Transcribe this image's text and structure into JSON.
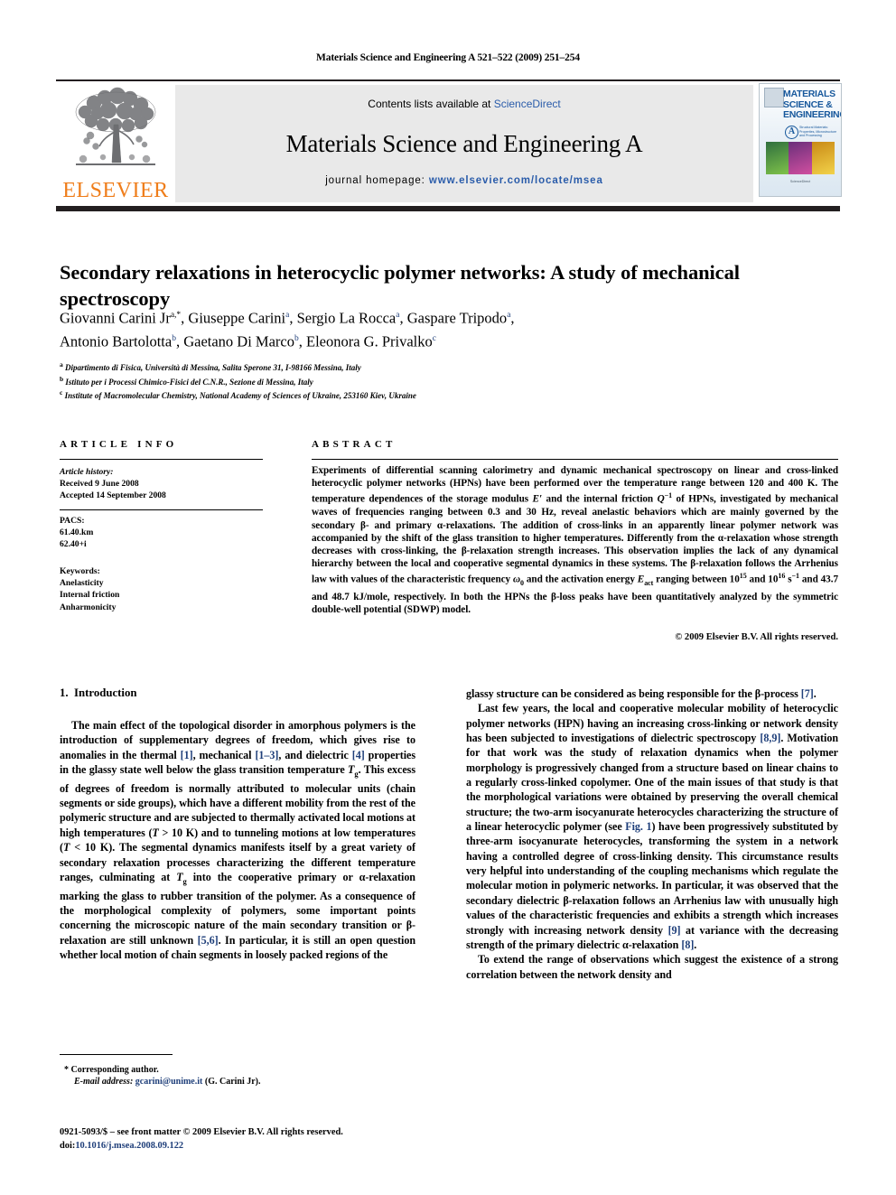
{
  "running_head": "Materials Science and Engineering A 521–522 (2009) 251–254",
  "masthead": {
    "contents_prefix": "Contents lists available at ",
    "sciencedirect": "ScienceDirect",
    "journal_name": "Materials Science and Engineering A",
    "homepage_prefix": "journal homepage:",
    "homepage_url": "www.elsevier.com/locate/msea",
    "publisher": "ELSEVIER",
    "publisher_logo": "elsevier-tree-logo",
    "cover": {
      "title_line1": "MATERIALS",
      "title_line2": "SCIENCE &",
      "title_line3": "ENGINEERING",
      "series_letter": "A",
      "subtitle": "Structural Materials: Properties, Microstructure and Processing",
      "footer": "ScienceDirect"
    },
    "accent_orange": "#ef7d1a",
    "accent_blue": "#2a5caa"
  },
  "article": {
    "title": "Secondary relaxations in heterocyclic polymer networks: A study of mechanical spectroscopy",
    "authors": [
      {
        "name": "Giovanni Carini Jr",
        "marks": "a,*"
      },
      {
        "name": "Giuseppe Carini",
        "marks": "a"
      },
      {
        "name": "Sergio La Rocca",
        "marks": "a"
      },
      {
        "name": "Gaspare Tripodo",
        "marks": "a"
      },
      {
        "name": "Antonio Bartolotta",
        "marks": "b"
      },
      {
        "name": "Gaetano Di Marco",
        "marks": "b"
      },
      {
        "name": "Eleonora G. Privalko",
        "marks": "c"
      }
    ],
    "affiliations": [
      {
        "mark": "a",
        "text": "Dipartimento di Fisica, Università di Messina, Salita Sperone 31, I-98166 Messina, Italy"
      },
      {
        "mark": "b",
        "text": "Istituto per i Processi Chimico-Fisici del C.N.R., Sezione di Messina, Italy"
      },
      {
        "mark": "c",
        "text": "Institute of Macromolecular Chemistry, National Academy of Sciences of Ukraine, 253160 Kiev, Ukraine"
      }
    ]
  },
  "info": {
    "heading": "ARTICLE INFO",
    "history_label": "Article history:",
    "received": "Received 9 June 2008",
    "accepted": "Accepted 14 September 2008",
    "pacs_label": "PACS:",
    "pacs": [
      "61.40.km",
      "62.40+i"
    ],
    "keywords_label": "Keywords:",
    "keywords": [
      "Anelasticity",
      "Internal friction",
      "Anharmonicity"
    ]
  },
  "abstract": {
    "heading": "ABSTRACT",
    "p1_a": "Experiments of differential scanning calorimetry and dynamic mechanical spectroscopy on linear and cross-linked heterocyclic polymer networks (HPNs) have been performed over the temperature range between 120 and 400 K. The temperature dependences of the storage modulus ",
    "sym_Eprime": "E′",
    "p1_b": " and the internal friction ",
    "sym_Q": "Q",
    "sym_Q_sup": "−1",
    "p1_c": " of HPNs, investigated by mechanical waves of frequencies ranging between 0.3 and 30 Hz, reveal anelastic behaviors which are mainly governed by the secondary β- and primary α-relaxations. The addition of cross-links in an apparently linear polymer network was accompanied by the shift of the glass transition to higher temperatures. Differently from the α-relaxation whose strength decreases with cross-linking, the β-relaxation strength increases. This observation implies the lack of any dynamical hierarchy between the local and cooperative segmental dynamics in these systems. The β-relaxation follows the Arrhenius law with values of the characteristic frequency ",
    "sym_omega": "ω",
    "sym_omega_sub": "0",
    "p1_d": " and the activation energy ",
    "sym_E": "E",
    "sym_E_sub": "act",
    "p1_e": " ranging between 10",
    "sym_exp15": "15",
    "p1_f": " and 10",
    "sym_exp16": "16",
    "p1_g": " s",
    "sym_expm1": "−1",
    "p1_h": " and 43.7 and 48.7 kJ/mole, respectively. In both the HPNs the β-loss peaks have been quantitatively analyzed by the symmetric double-well potential (SDWP) model.",
    "copyright": "© 2009 Elsevier B.V. All rights reserved."
  },
  "body": {
    "section_number": "1.",
    "section_title": "Introduction",
    "left": {
      "p1_a": "The main effect of the topological disorder in amorphous polymers is the introduction of supplementary degrees of freedom, which gives rise to anomalies in the thermal ",
      "r1": "[1]",
      "p1_b": ", mechanical ",
      "r2": "[1–3]",
      "p1_c": ", and dielectric ",
      "r3": "[4]",
      "p1_d": " properties in the glassy state well below the glass transition temperature ",
      "sym_Tg": "T",
      "sym_Tg_sub": "g",
      "p1_e": ". This excess of degrees of freedom is normally attributed to molecular units (chain segments or side groups), which have a different mobility from the rest of the polymeric structure and are subjected to thermally activated local motions at high temperatures (",
      "sym_T1": "T",
      "p1_f": " > 10 K) and to tunneling motions at low temperatures (",
      "sym_T2": "T",
      "p1_g": " < 10 K). The segmental dynamics manifests itself by a great variety of secondary relaxation processes characterizing the different temperature ranges, culminating at ",
      "sym_Tg2": "T",
      "sym_Tg2_sub": "g",
      "p1_h": " into the cooperative primary or α-relaxation marking the glass to rubber transition of the polymer. As a consequence of the morphological complexity of polymers, some important points concerning the microscopic nature of the main secondary transition or β-relaxation are still unknown ",
      "r4": "[5,6]",
      "p1_i": ". In particular, it is still an open question whether local motion of chain segments in loosely packed regions of the"
    },
    "right": {
      "p1_a": "glassy structure can be considered as being responsible for the β-process ",
      "r5": "[7]",
      "p1_b": ".",
      "p2_a": "Last few years, the local and cooperative molecular mobility of heterocyclic polymer networks (HPN) having an increasing cross-linking or network density has been subjected to investigations of dielectric spectroscopy ",
      "r6": "[8,9]",
      "p2_b": ". Motivation for that work was the study of relaxation dynamics when the polymer morphology is progressively changed from a structure based on linear chains to a regularly cross-linked copolymer. One of the main issues of that study is that the morphological variations were obtained by preserving the overall chemical structure; the two-arm isocyanurate heterocycles characterizing the structure of a linear heterocyclic polymer (see ",
      "figref": "Fig. 1",
      "p2_c": ") have been progressively substituted by three-arm isocyanurate heterocycles, transforming the system in a network having a controlled degree of cross-linking density. This circumstance results very helpful into understanding of the coupling mechanisms which regulate the molecular motion in polymeric networks. In particular, it was observed that the secondary dielectric β-relaxation follows an Arrhenius law with unusually high values of the characteristic frequencies and exhibits a strength which increases strongly with increasing network density ",
      "r7": "[9]",
      "p2_d": " at variance with the decreasing strength of the primary dielectric α-relaxation ",
      "r8": "[8]",
      "p2_e": ".",
      "p3": "To extend the range of observations which suggest the existence of a strong correlation between the network density and"
    }
  },
  "footnote": {
    "star": "*",
    "corresponding": "Corresponding author.",
    "email_label": "E-mail address:",
    "email": "gcarini@unime.it",
    "email_owner": "(G. Carini Jr).",
    "issn_line": "0921-5093/$ – see front matter © 2009 Elsevier B.V. All rights reserved.",
    "doi_label": "doi:",
    "doi": "10.1016/j.msea.2008.09.122"
  }
}
